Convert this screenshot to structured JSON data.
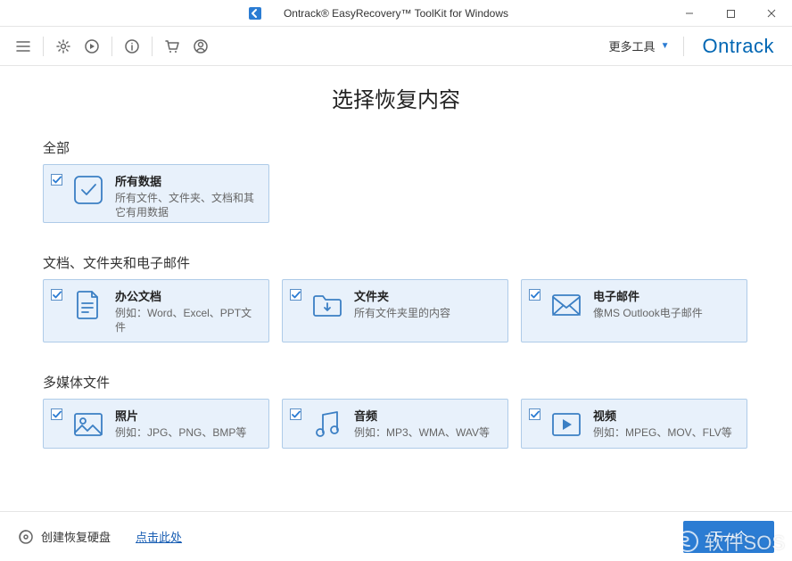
{
  "window": {
    "title": "Ontrack® EasyRecovery™ ToolKit for Windows"
  },
  "toolbar": {
    "more_tools": "更多工具",
    "brand": "Ontrack"
  },
  "page": {
    "title": "选择恢复内容"
  },
  "sections": {
    "all": {
      "label": "全部",
      "card": {
        "title": "所有数据",
        "desc": "所有文件、文件夹、文档和其它有用数据"
      }
    },
    "docs": {
      "label": "文档、文件夹和电子邮件",
      "cards": [
        {
          "title": "办公文档",
          "desc": "例如：Word、Excel、PPT文件"
        },
        {
          "title": "文件夹",
          "desc": "所有文件夹里的内容"
        },
        {
          "title": "电子邮件",
          "desc": "像MS Outlook电子邮件"
        }
      ]
    },
    "media": {
      "label": "多媒体文件",
      "cards": [
        {
          "title": "照片",
          "desc": "例如：JPG、PNG、BMP等"
        },
        {
          "title": "音频",
          "desc": "例如：MP3、WMA、WAV等"
        },
        {
          "title": "视频",
          "desc": "例如：MPEG、MOV、FLV等"
        }
      ]
    }
  },
  "footer": {
    "create_disk": "创建恢复硬盘",
    "click_here": "点击此处",
    "next": "下一个"
  },
  "watermark": "软件SOS"
}
